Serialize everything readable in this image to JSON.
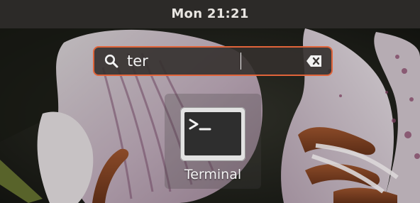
{
  "topbar": {
    "clock": "Mon 21:21"
  },
  "search": {
    "value": "ter",
    "placeholder": "",
    "icon": "search-icon",
    "clear_icon": "clear-text-icon"
  },
  "results": [
    {
      "label": "Terminal",
      "icon": "terminal-icon"
    }
  ],
  "colors": {
    "topbar_bg": "#2c2a28",
    "accent": "#e0643a",
    "text": "#f2f2f2"
  }
}
